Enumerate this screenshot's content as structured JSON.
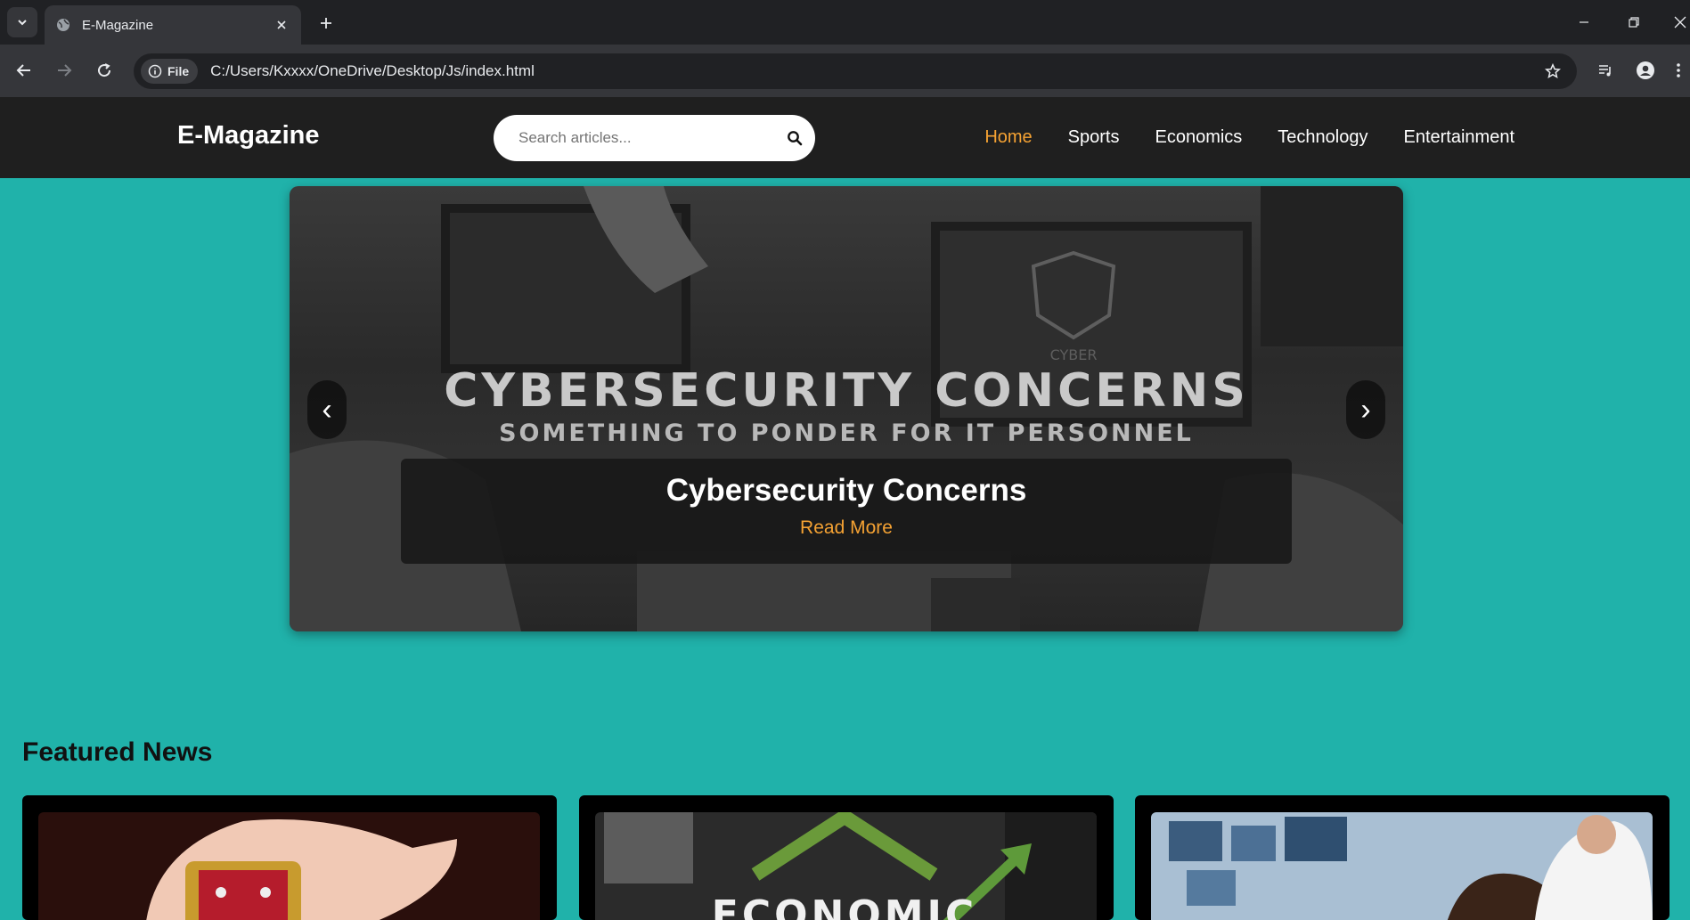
{
  "browser": {
    "tab_title": "E-Magazine",
    "site_chip": "File",
    "url": "C:/Users/Kxxxx/OneDrive/Desktop/Js/index.html"
  },
  "site": {
    "logo": "E-Magazine",
    "search_placeholder": "Search articles...",
    "nav": [
      {
        "label": "Home",
        "active": true
      },
      {
        "label": "Sports",
        "active": false
      },
      {
        "label": "Economics",
        "active": false
      },
      {
        "label": "Technology",
        "active": false
      },
      {
        "label": "Entertainment",
        "active": false
      }
    ]
  },
  "hero": {
    "image_headline": "CYBERSECURITY CONCERNS",
    "image_subheadline": "SOMETHING TO PONDER FOR IT PERSONNEL",
    "image_badge": "CYBER",
    "title": "Cybersecurity Concerns",
    "read_more": "Read More",
    "prev_arrow": "‹",
    "next_arrow": "›"
  },
  "featured": {
    "heading": "Featured News",
    "card2_image_text": "ECONOMIC"
  },
  "colors": {
    "page_bg": "#20b2aa",
    "header_bg": "#1f1f1f",
    "accent": "#f5a233"
  }
}
